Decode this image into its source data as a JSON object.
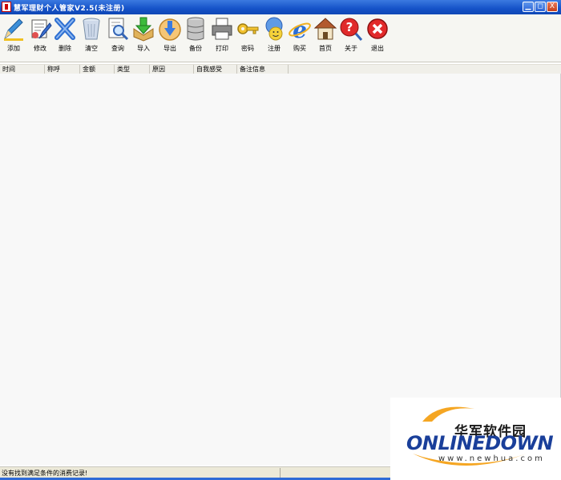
{
  "window": {
    "title": "慧军理财个人管家V2.5(未注册)",
    "minimize_symbol": "▁",
    "maximize_symbol": "◻",
    "close_symbol": "X"
  },
  "toolbar": {
    "items": [
      {
        "label": "添加",
        "icon": "add-pencil-icon"
      },
      {
        "label": "修改",
        "icon": "edit-icon"
      },
      {
        "label": "删除",
        "icon": "delete-x-icon"
      },
      {
        "label": "清空",
        "icon": "trash-can-icon"
      },
      {
        "label": "查询",
        "icon": "search-document-icon"
      },
      {
        "label": "导入",
        "icon": "import-icon"
      },
      {
        "label": "导出",
        "icon": "export-icon"
      },
      {
        "label": "备份",
        "icon": "database-icon"
      },
      {
        "label": "打印",
        "icon": "printer-icon"
      },
      {
        "label": "密码",
        "icon": "key-icon"
      },
      {
        "label": "注册",
        "icon": "register-icon"
      },
      {
        "label": "购买",
        "icon": "ie-browser-icon"
      },
      {
        "label": "首页",
        "icon": "home-icon"
      },
      {
        "label": "关于",
        "icon": "help-icon"
      },
      {
        "label": "退出",
        "icon": "exit-icon"
      }
    ]
  },
  "table": {
    "columns": [
      "时间",
      "称呼",
      "金额",
      "类型",
      "原因",
      "自我感受",
      "备注信息"
    ],
    "rows": []
  },
  "status": {
    "message": "没有找到满足条件的消费记录!"
  },
  "watermark": {
    "chinese": "华军软件园",
    "brand": "ONLINEDOWN",
    "url": "www.newhua.com"
  },
  "colors": {
    "titlebar": "#1552c8",
    "toolbar_bg": "#f6f6f2",
    "grid_bg": "#f8f8f8",
    "brand_blue": "#1a3f9a",
    "brand_orange": "#f5a623"
  }
}
